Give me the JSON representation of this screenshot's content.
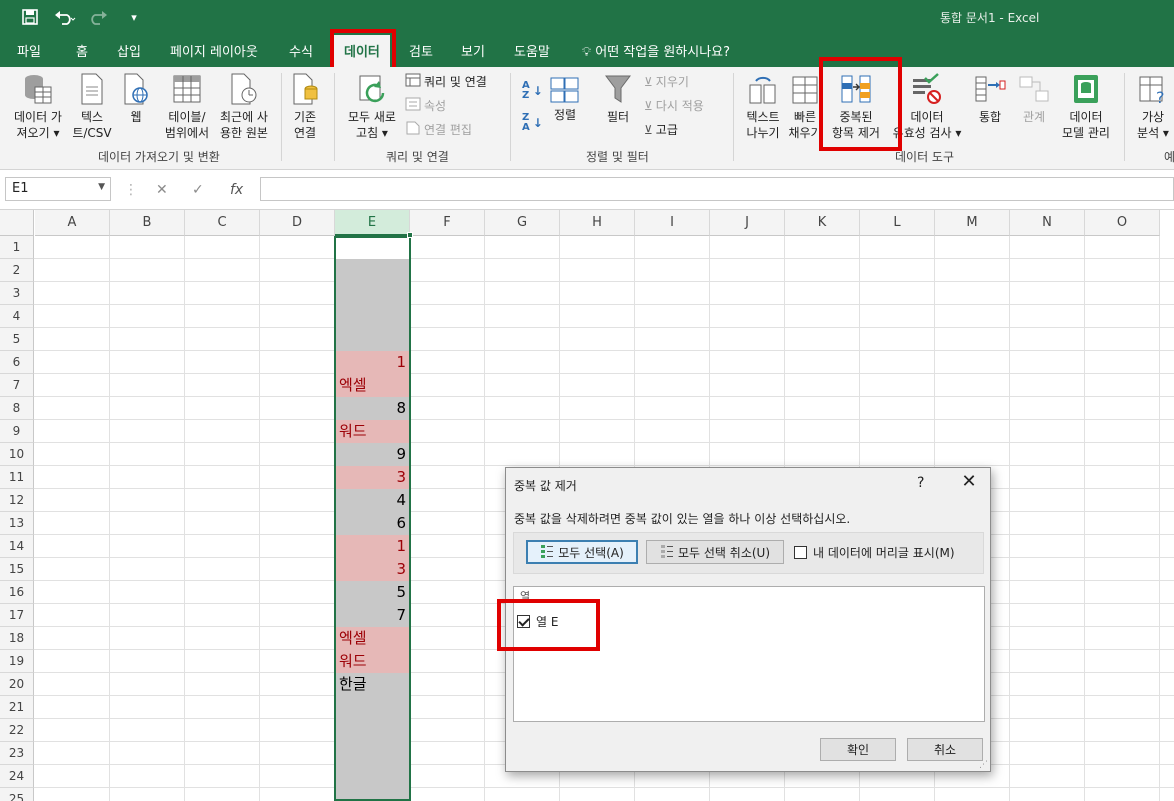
{
  "title_bar": {
    "document_title": "통합 문서1  -  Excel",
    "save_icon": "save-icon",
    "undo_icon": "undo-icon",
    "redo_icon": "redo-icon",
    "customize_icon": "customize-quick-access-icon"
  },
  "menu_tabs": [
    "파일",
    "홈",
    "삽입",
    "페이지 레이아웃",
    "수식",
    "데이터",
    "검토",
    "보기",
    "도움말"
  ],
  "active_tab": "데이터",
  "tell_me": "어떤 작업을 원하시나요?",
  "ribbon": {
    "get_data": {
      "line1": "데이터 가",
      "line2": "져오기 ▾"
    },
    "text_csv": {
      "line1": "텍스",
      "line2": "트/CSV"
    },
    "web": {
      "line1": "웹"
    },
    "table_range": {
      "line1": "테이블/",
      "line2": "범위에서"
    },
    "recent_sources": {
      "line1": "최근에 사",
      "line2": "용한 원본"
    },
    "existing_conn": {
      "line1": "기존",
      "line2": "연결"
    },
    "group1_label": "데이터 가져오기 및 변환",
    "refresh_all": {
      "line1": "모두 새로",
      "line2": "고침 ▾"
    },
    "queries_conn": "쿼리 및 연결",
    "properties": "속성",
    "edit_links": "연결 편집",
    "group2_label": "쿼리 및 연결",
    "sort_az": "↓",
    "sort_za": "↓",
    "sort": "정렬",
    "filter": "필터",
    "clear": "지우기",
    "reapply": "다시 적용",
    "advanced": "고급",
    "group3_label": "정렬 및 필터",
    "text_to_columns": {
      "line1": "텍스트",
      "line2": "나누기"
    },
    "flash_fill": {
      "line1": "빠른",
      "line2": "채우기"
    },
    "remove_duplicates": {
      "line1": "중복된",
      "line2": "항목 제거"
    },
    "data_validation": {
      "line1": "데이터",
      "line2": "유효성 검사 ▾"
    },
    "consolidate": {
      "line1": "통합"
    },
    "relationships": {
      "line1": "관계"
    },
    "data_model": {
      "line1": "데이터",
      "line2": "모델 관리"
    },
    "group4_label": "데이터 도구",
    "what_if": {
      "line1": "가상",
      "line2": "분석 ▾"
    },
    "group5_label": "예"
  },
  "formula_bar": {
    "name_box": "E1",
    "cancel_icon": "✕",
    "enter_icon": "✓",
    "fx": "fx",
    "formula": ""
  },
  "grid": {
    "columns": [
      "A",
      "B",
      "C",
      "D",
      "E",
      "F",
      "G",
      "H",
      "I",
      "J",
      "K",
      "L",
      "M",
      "N",
      "O"
    ],
    "rows": [
      "1",
      "2",
      "3",
      "4",
      "5",
      "6",
      "7",
      "8",
      "9",
      "10",
      "11",
      "12",
      "13",
      "14",
      "15",
      "16",
      "17",
      "18",
      "19",
      "20",
      "21",
      "22",
      "23",
      "24",
      "25"
    ],
    "column_e_values": [
      "",
      "",
      "",
      "",
      "",
      "1",
      "엑셀",
      "8",
      "워드",
      "9",
      "3",
      "4",
      "6",
      "1",
      "3",
      "5",
      "7",
      "엑셀",
      "워드",
      "한글",
      "",
      "",
      "",
      "",
      ""
    ],
    "duplicate_highlight": "#e6b8b7",
    "selection_fill": "#c8c8c8"
  },
  "dialog": {
    "title": "중복 값 제거",
    "help": "?",
    "close": "✕",
    "instruction": "중복 값을 삭제하려면 중복 값이 있는 열을 하나 이상 선택하십시오.",
    "select_all": "모두 선택(A)",
    "unselect_all": "모두 선택 취소(U)",
    "has_headers": "내 데이터에 머리글 표시(M)",
    "has_headers_checked": false,
    "list_header": "열",
    "columns": [
      {
        "label": "열 E",
        "checked": true
      }
    ],
    "ok": "확인",
    "cancel": "취소"
  }
}
